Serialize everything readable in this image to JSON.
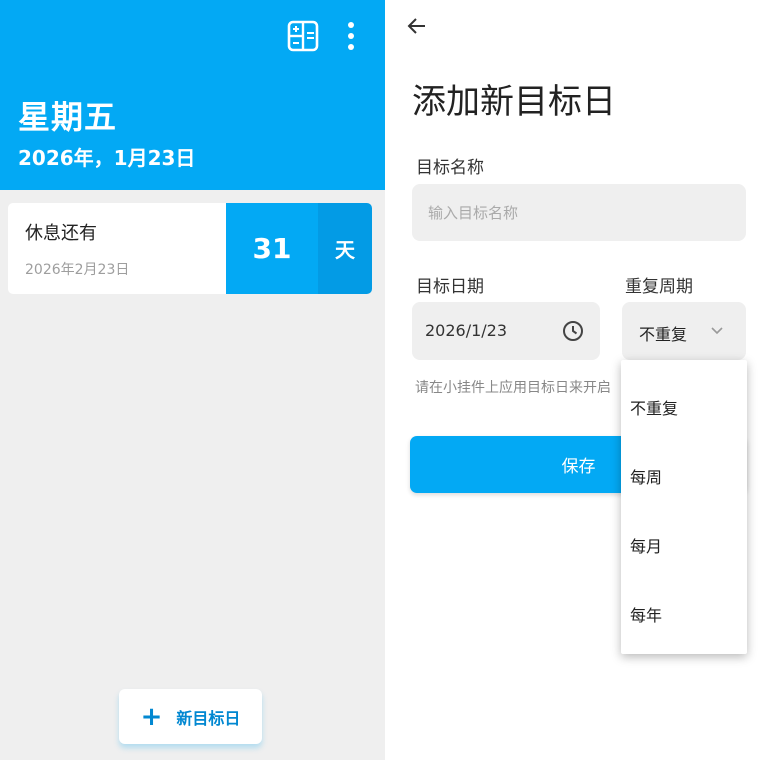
{
  "colors": {
    "accent": "#03a9f4",
    "accent_dark": "#039be5",
    "background": "#efefef"
  },
  "home": {
    "weekday": "星期五",
    "date": "2026年，1月23日",
    "icons": {
      "calculator": "calculator-icon",
      "more": "more-vertical-icon"
    },
    "card": {
      "title": "休息还有",
      "target_date": "2026年2月23日",
      "count": "31",
      "unit": "天"
    },
    "fab": {
      "icon": "plus-icon",
      "label": "新目标日"
    }
  },
  "form": {
    "back_icon": "arrow-left-icon",
    "title": "添加新目标日",
    "name_label": "目标名称",
    "name_placeholder": "输入目标名称",
    "name_value": "",
    "date_label": "目标日期",
    "date_value": "2026/1/23",
    "date_icon": "clock-icon",
    "repeat_label": "重复周期",
    "repeat_value": "不重复",
    "repeat_icon": "chevron-down-icon",
    "hint": "请在小挂件上应用目标日来开启",
    "save_label": "保存",
    "repeat_options": [
      "不重复",
      "每周",
      "每月",
      "每年"
    ]
  }
}
